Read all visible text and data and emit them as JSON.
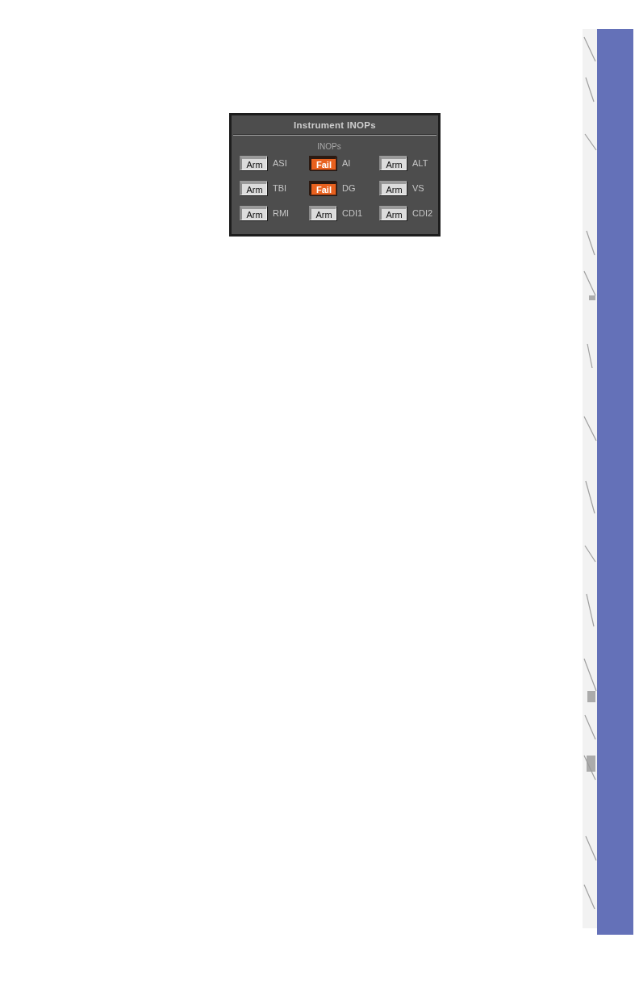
{
  "panel": {
    "title": "Instrument INOPs",
    "section_label": "INOPs",
    "instruments": [
      {
        "button": "Arm",
        "label": "ASI",
        "failed": false
      },
      {
        "button": "Fail",
        "label": "AI",
        "failed": true
      },
      {
        "button": "Arm",
        "label": "ALT",
        "failed": false
      },
      {
        "button": "Arm",
        "label": "TBI",
        "failed": false
      },
      {
        "button": "Fail",
        "label": "DG",
        "failed": true
      },
      {
        "button": "Arm",
        "label": "VS",
        "failed": false
      },
      {
        "button": "Arm",
        "label": "RMI",
        "failed": false
      },
      {
        "button": "Arm",
        "label": "CDI1",
        "failed": false
      },
      {
        "button": "Arm",
        "label": "CDI2",
        "failed": false
      }
    ]
  }
}
